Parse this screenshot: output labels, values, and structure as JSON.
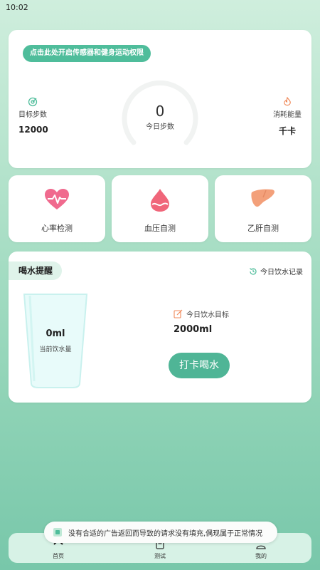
{
  "status_bar": {
    "time": "10:02"
  },
  "steps": {
    "permission_button": "点击此处开启传感器和健身运动权限",
    "today_steps_value": "0",
    "today_steps_label": "今日步数",
    "target_label": "目标步数",
    "target_value": "12000",
    "energy_label": "消耗能量",
    "energy_value": "千卡"
  },
  "features": [
    {
      "label": "心率检测",
      "icon": "heart-rate-icon"
    },
    {
      "label": "血压自测",
      "icon": "blood-drop-icon"
    },
    {
      "label": "乙肝自测",
      "icon": "liver-icon"
    }
  ],
  "water": {
    "title": "喝水提醒",
    "history_link": "今日饮水记录",
    "current_value": "0ml",
    "current_label": "当前饮水量",
    "goal_label": "今日饮水目标",
    "goal_value": "2000ml",
    "checkin_button": "打卡喝水"
  },
  "bottom_nav": [
    {
      "label": "首页",
      "icon": "home-icon"
    },
    {
      "label": "测试",
      "icon": "test-icon"
    },
    {
      "label": "我的",
      "icon": "profile-icon"
    }
  ],
  "toast": {
    "message": "没有合适的广告返回而导致的请求没有填充,偶现属于正常情况"
  },
  "colors": {
    "accent": "#4fbd9b",
    "button": "#4fb596",
    "heart": "#f06a8e",
    "blood": "#f0667a",
    "liver": "#f3a07a"
  }
}
